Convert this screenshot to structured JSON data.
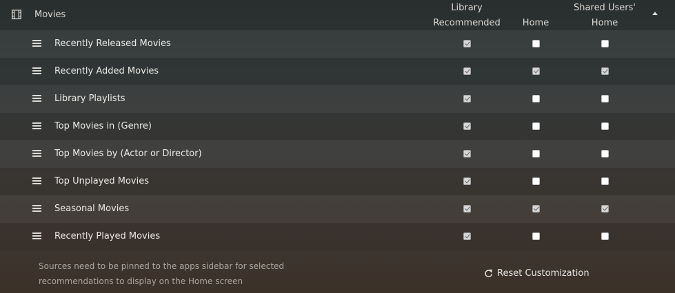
{
  "header": {
    "icon": "film-icon",
    "title": "Movies",
    "columns": {
      "library": [
        "Library",
        "Recommended"
      ],
      "home": "Home",
      "shared": [
        "Shared Users'",
        "Home"
      ]
    },
    "sort_icon": "sort-up-triangle-icon"
  },
  "rows": [
    {
      "label": "Recently Released Movies",
      "library": true,
      "home": false,
      "shared": false
    },
    {
      "label": "Recently Added Movies",
      "library": true,
      "home": true,
      "shared": true
    },
    {
      "label": "Library Playlists",
      "library": true,
      "home": false,
      "shared": false
    },
    {
      "label": "Top Movies in (Genre)",
      "library": true,
      "home": false,
      "shared": false
    },
    {
      "label": "Top Movies by (Actor or Director)",
      "library": true,
      "home": false,
      "shared": false
    },
    {
      "label": "Top Unplayed Movies",
      "library": true,
      "home": false,
      "shared": false
    },
    {
      "label": "Seasonal Movies",
      "library": true,
      "home": true,
      "shared": true
    },
    {
      "label": "Recently Played Movies",
      "library": true,
      "home": false,
      "shared": false
    }
  ],
  "footer": {
    "note_line1": "Sources need to be pinned to the apps sidebar for selected",
    "note_line2": "recommendations to display on the Home screen",
    "reset_label": "Reset Customization",
    "reset_icon": "reset-icon"
  }
}
